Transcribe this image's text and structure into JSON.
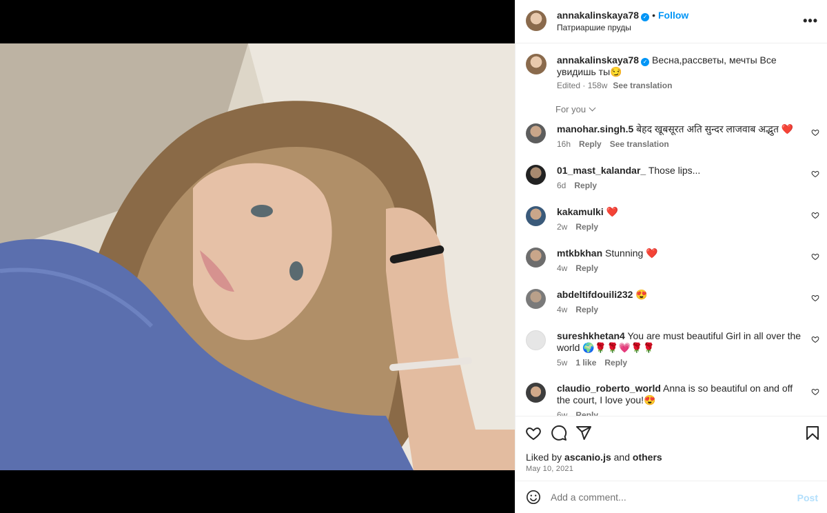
{
  "post": {
    "username": "annakalinskaya78",
    "follow_label": "Follow",
    "location": "Патриаршие пруды",
    "more_label": "•••"
  },
  "caption": {
    "username": "annakalinskaya78",
    "text": "Весна,рассветы, мечты Все увидишь ты😏",
    "edited": "Edited · 158w",
    "translate_label": "See translation"
  },
  "sort": {
    "label": "For you"
  },
  "comments": [
    {
      "user": "manohar.singh.5",
      "text": "बेहद खूबसूरत अति सुन्दर लाजवाब अद्भुत ❤️",
      "time": "16h",
      "reply": "Reply",
      "extra": "See translation"
    },
    {
      "user": "01_mast_kalandar_",
      "text": "Those lips...",
      "time": "6d",
      "reply": "Reply"
    },
    {
      "user": "kakamulki",
      "text": "❤️",
      "time": "2w",
      "reply": "Reply"
    },
    {
      "user": "mtkbkhan",
      "text": "Stunning ❤️",
      "time": "4w",
      "reply": "Reply"
    },
    {
      "user": "abdeltifdouili232",
      "text": "😍",
      "time": "4w",
      "reply": "Reply"
    },
    {
      "user": "sureshkhetan4",
      "text": "You are must beautiful Girl in all over the world 🌍🌹🌹💗🌹🌹",
      "time": "5w",
      "likes": "1 like",
      "reply": "Reply"
    },
    {
      "user": "claudio_roberto_world",
      "text": "Anna is so beautiful on and off the court, I love you!😍",
      "time": "6w",
      "reply": "Reply"
    }
  ],
  "likes": {
    "prefix": "Liked by",
    "user": "ascanio.js",
    "joiner": "and",
    "others": "others"
  },
  "date": "May 10, 2021",
  "add_comment": {
    "placeholder": "Add a comment...",
    "post_label": "Post"
  },
  "colors": {
    "accent": "#0095f6",
    "muted": "#737373",
    "post_disabled": "#b2dffc"
  }
}
